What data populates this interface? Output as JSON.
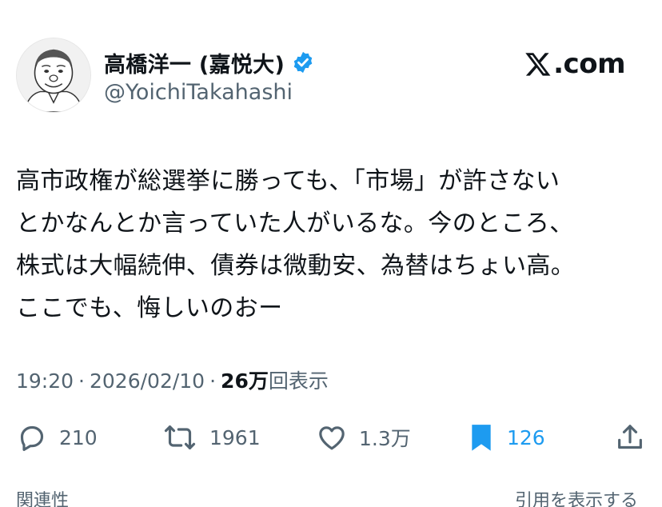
{
  "author": {
    "display_name": "高橋洋一 (嘉悦大)",
    "handle": "@YoichiTakahashi",
    "verified": true
  },
  "site": {
    "logo_letter": "X",
    "domain": ".com"
  },
  "post": {
    "lines": [
      "高市政権が総選挙に勝っても、「市場」が許さない",
      "とかなんとか言っていた人がいるな。今のところ、",
      "株式は大幅続伸、債券は微動安、為替はちょい高。",
      "ここでも、悔しいのおー"
    ]
  },
  "meta": {
    "time": "19:20",
    "separator": "·",
    "date": "2026/02/10",
    "views_count": "26万",
    "views_label": "回表示"
  },
  "actions": {
    "replies": "210",
    "reposts": "1961",
    "likes": "1.3万",
    "bookmarks": "126"
  },
  "footer": {
    "left_label": "関連性",
    "right_label": "引用を表示する"
  },
  "colors": {
    "text": "#0f1419",
    "secondary": "#536471",
    "accent": "#1d9bf0"
  }
}
